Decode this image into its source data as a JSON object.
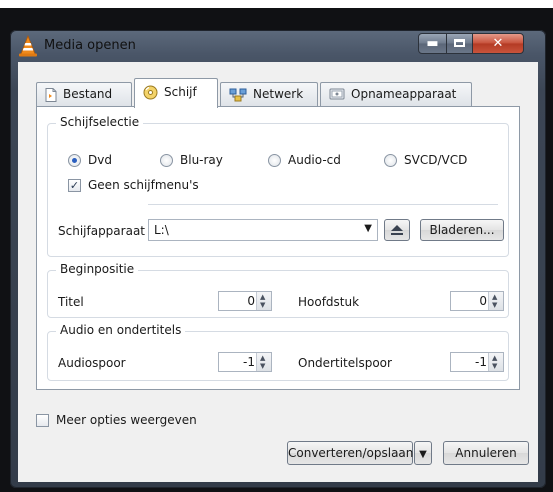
{
  "window": {
    "title": "Media openen"
  },
  "tabs": [
    {
      "label": "Bestand",
      "icon": "file-icon"
    },
    {
      "label": "Schijf",
      "icon": "disc-icon"
    },
    {
      "label": "Netwerk",
      "icon": "network-icon"
    },
    {
      "label": "Opnameapparaat",
      "icon": "capture-device-icon"
    }
  ],
  "active_tab": "Schijf",
  "disc_selection": {
    "title": "Schijfselectie",
    "options": [
      {
        "label": "Dvd",
        "selected": true
      },
      {
        "label": "Blu-ray",
        "selected": false
      },
      {
        "label": "Audio-cd",
        "selected": false
      },
      {
        "label": "SVCD/VCD",
        "selected": false
      }
    ],
    "no_menus_label": "Geen schijfmenu's",
    "no_menus_checked": true,
    "device_label": "Schijfapparaat",
    "device_value": "L:\\",
    "browse_label": "Bladeren..."
  },
  "start_position": {
    "title": "Beginpositie",
    "title_label": "Titel",
    "title_value": "0",
    "chapter_label": "Hoofdstuk",
    "chapter_value": "0"
  },
  "audio_subtitles": {
    "title": "Audio en ondertitels",
    "audio_label": "Audiospoor",
    "audio_value": "-1",
    "subtitle_label": "Ondertitelspoor",
    "subtitle_value": "-1"
  },
  "footer": {
    "more_options_label": "Meer opties weergeven",
    "more_options_checked": false,
    "convert_label": "Converteren/opslaan",
    "cancel_label": "Annuleren"
  }
}
